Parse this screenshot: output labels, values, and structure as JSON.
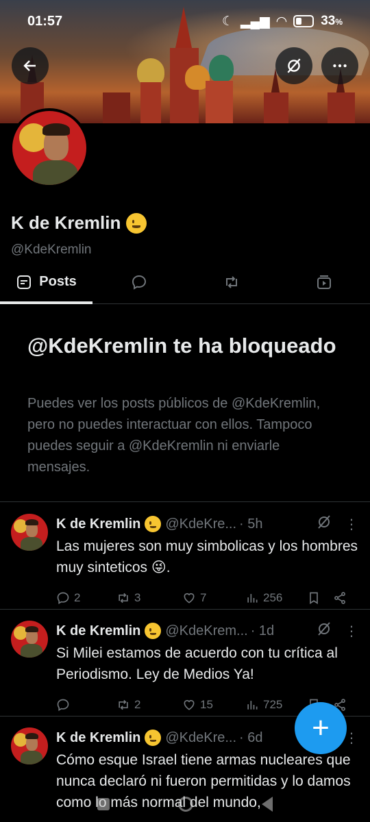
{
  "status_bar": {
    "time": "01:57",
    "battery": "33",
    "battery_unit": "%"
  },
  "header": {
    "back_icon": "arrow-left-icon",
    "grok_icon": "grok-icon",
    "more_icon": "more-horizontal-icon"
  },
  "profile": {
    "name": "K de Kremlin",
    "handle": "@KdeKremlin",
    "emoji": "winking-face"
  },
  "tabs": [
    {
      "label": "Posts",
      "icon": "posts-icon",
      "active": true
    },
    {
      "label": "",
      "icon": "replies-icon",
      "active": false
    },
    {
      "label": "",
      "icon": "retweet-icon",
      "active": false
    },
    {
      "label": "",
      "icon": "media-icon",
      "active": false
    }
  ],
  "block_notice": {
    "title": "@KdeKremlin te ha bloqueado",
    "text": "Puedes ver los posts públicos de @KdeKremlin, pero no puedes interactuar con ellos. Tampoco puedes seguir a @KdeKremlin ni enviarle mensajes."
  },
  "tweets": [
    {
      "name": "K de Kremlin",
      "handle": "@KdeKre...",
      "time": "· 5h",
      "text": "Las mujeres son muy simbolicas y los hombres muy sinteticos 😜.",
      "replies": "2",
      "retweets": "3",
      "likes": "7",
      "views": "256"
    },
    {
      "name": "K de Kremlin",
      "handle": "@KdeKrem...",
      "time": "· 1d",
      "text": "Si Milei estamos de acuerdo con tu crítica al Periodismo. Ley de Medios Ya!",
      "replies": "",
      "retweets": "2",
      "likes": "15",
      "views": "725"
    },
    {
      "name": "K de Kremlin",
      "handle": "@KdeKre...",
      "time": "· 6d",
      "text": "Cómo esque Israel tiene armas nucleares que nunca declaró ni fueron permitidas y lo damos como lo más normal del mundo,"
    }
  ],
  "fab": {
    "label": "+"
  },
  "colors": {
    "accent": "#1d9bf0",
    "background": "#000000",
    "muted": "#71767b",
    "text": "#e7e9ea"
  }
}
